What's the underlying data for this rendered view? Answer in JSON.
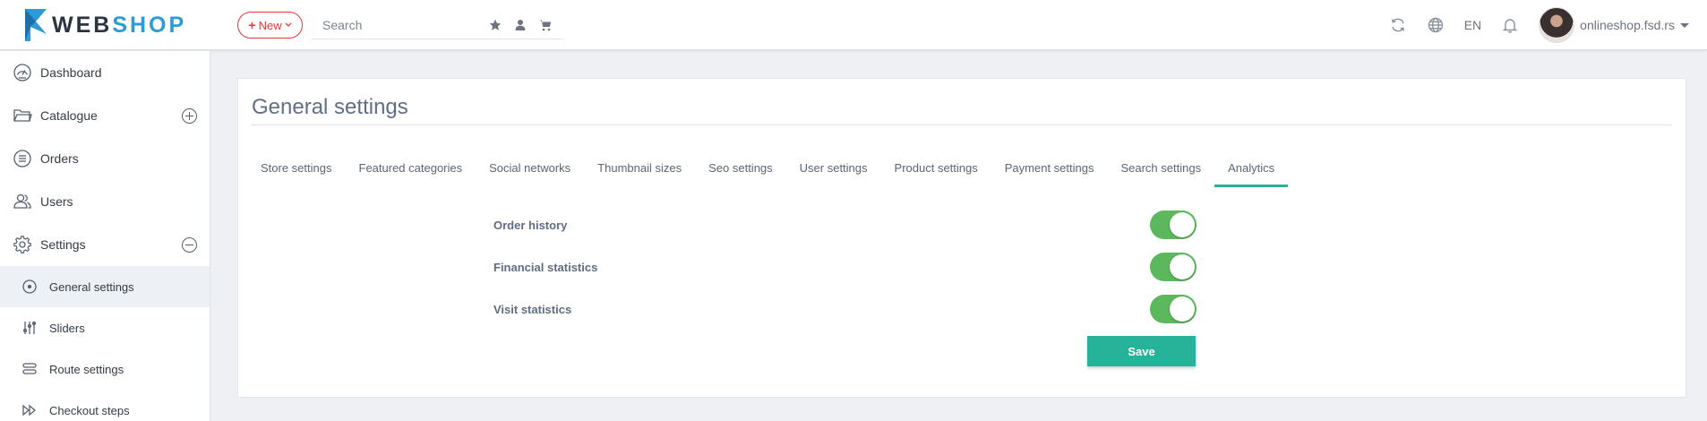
{
  "brand": {
    "part1": "WEB",
    "part2": "SHOP",
    "mark_color": "#2f9bd6"
  },
  "header": {
    "new_label": "New",
    "search_placeholder": "Search",
    "search_icons": [
      "star-icon",
      "user-icon",
      "cart-icon"
    ],
    "lang": "EN",
    "user_name": "onlineshop.fsd.rs",
    "icons": [
      "refresh-icon",
      "globe-icon",
      "bell-icon"
    ]
  },
  "sidebar": {
    "items": [
      {
        "label": "Dashboard",
        "icon": "dashboard-icon"
      },
      {
        "label": "Catalogue",
        "icon": "folder-icon",
        "expand": "plus"
      },
      {
        "label": "Orders",
        "icon": "list-icon"
      },
      {
        "label": "Users",
        "icon": "users-icon"
      },
      {
        "label": "Settings",
        "icon": "gear-icon",
        "expand": "minus"
      }
    ],
    "subitems": [
      {
        "label": "General settings",
        "icon": "target-icon",
        "active": true
      },
      {
        "label": "Sliders",
        "icon": "sliders-icon"
      },
      {
        "label": "Route settings",
        "icon": "route-icon"
      },
      {
        "label": "Checkout steps",
        "icon": "steps-icon"
      }
    ]
  },
  "main": {
    "title": "General settings",
    "tabs": [
      {
        "label": "Store settings"
      },
      {
        "label": "Featured categories"
      },
      {
        "label": "Social networks"
      },
      {
        "label": "Thumbnail sizes"
      },
      {
        "label": "Seo settings"
      },
      {
        "label": "User settings"
      },
      {
        "label": "Product settings"
      },
      {
        "label": "Payment settings"
      },
      {
        "label": "Search settings"
      },
      {
        "label": "Analytics",
        "active": true
      }
    ],
    "settings": [
      {
        "label": "Order history",
        "enabled": true
      },
      {
        "label": "Financial statistics",
        "enabled": true
      },
      {
        "label": "Visit statistics",
        "enabled": true
      }
    ],
    "save_label": "Save"
  },
  "colors": {
    "accent": "#26b399",
    "toggle_on": "#5cb85c",
    "new_button": "#e03a3a"
  }
}
